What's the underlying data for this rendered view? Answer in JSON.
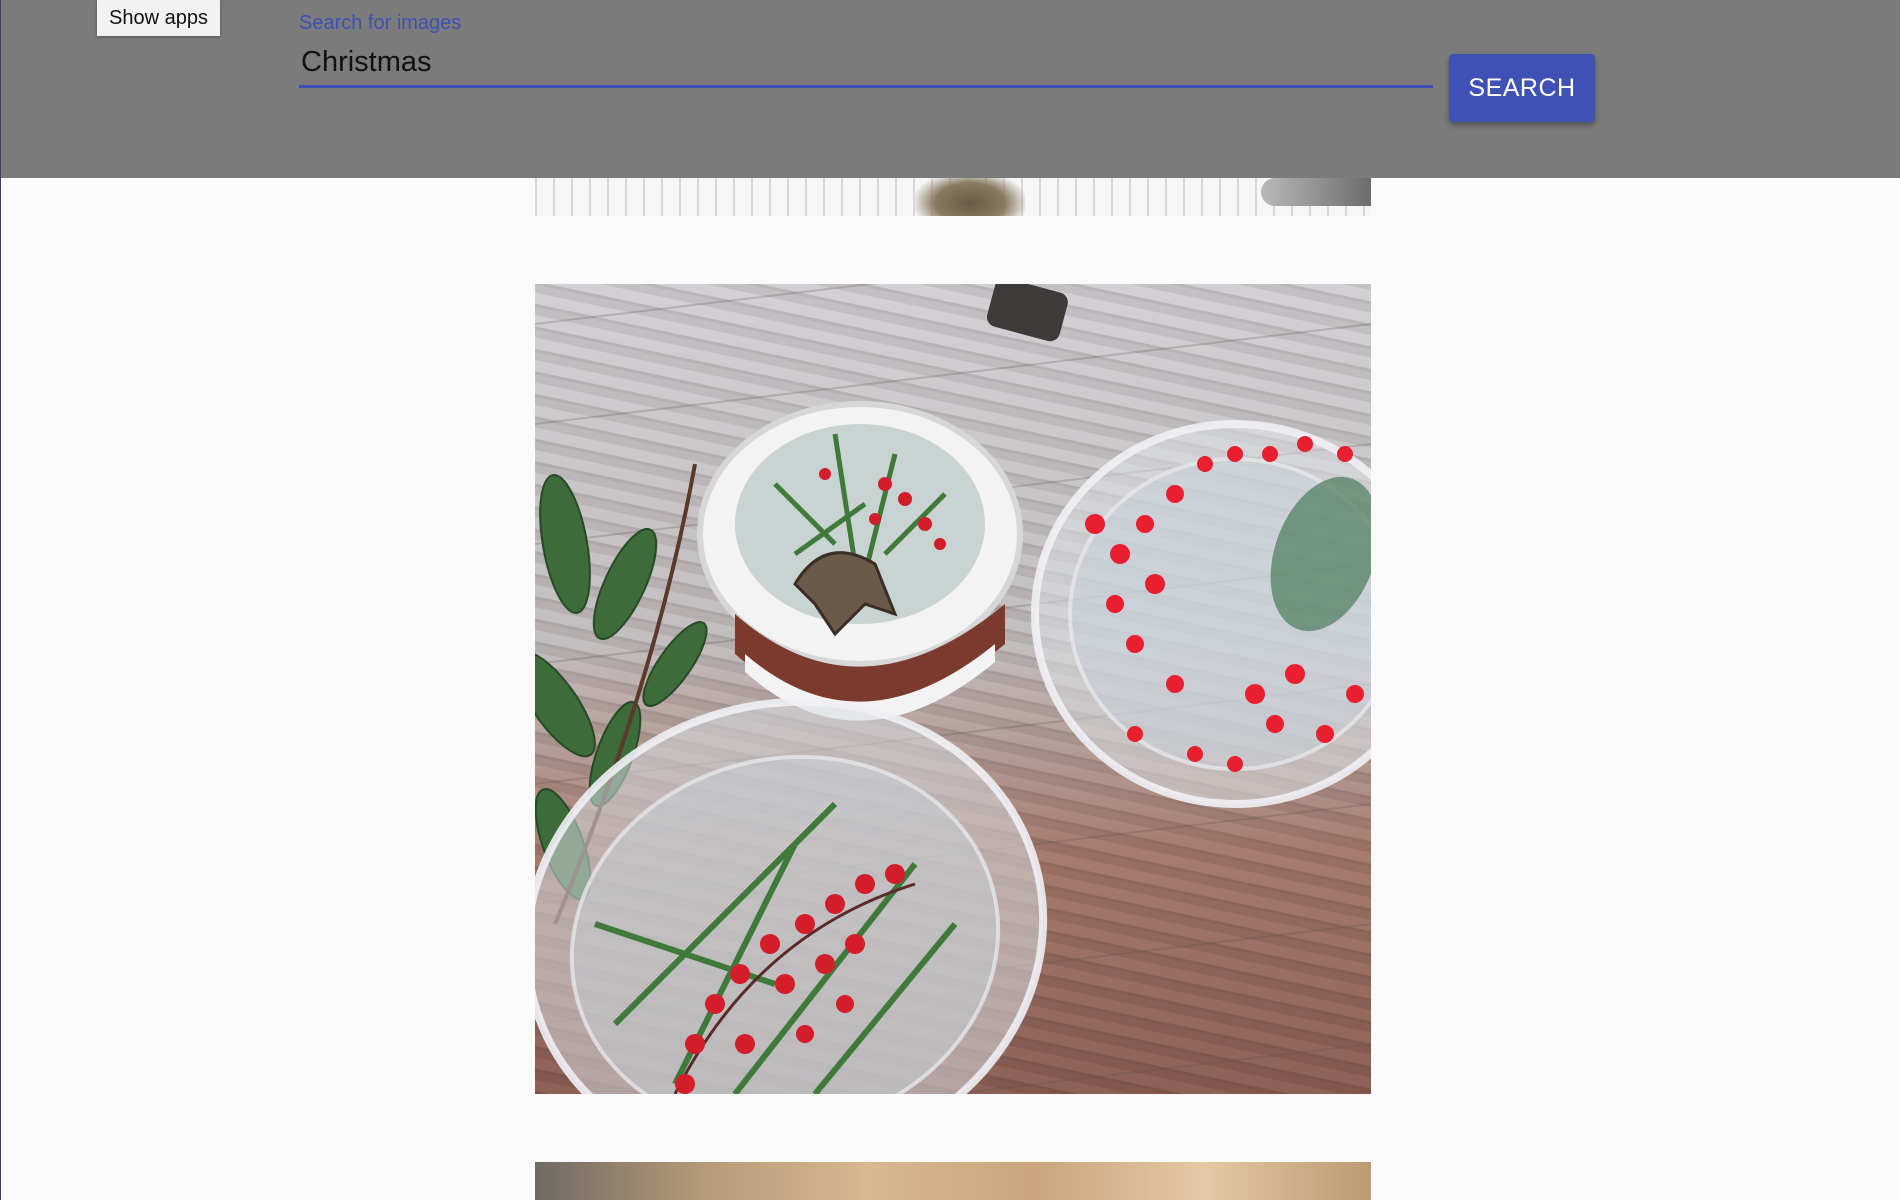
{
  "header": {
    "show_apps_label": "Show apps",
    "search": {
      "label": "Search for images",
      "value": "Christmas",
      "button_label": "SEARCH"
    }
  },
  "colors": {
    "app_bar": "#7b7b7b",
    "accent": "#3f51b5",
    "page_background": "#fafafa"
  },
  "results": [
    {
      "description": "snowy landscape (partially scrolled out of view)"
    },
    {
      "description": "bowls of water with evergreen sprigs, red berries and a reindeer ornament on a wooden table"
    },
    {
      "description": "next image (partially visible)"
    }
  ]
}
